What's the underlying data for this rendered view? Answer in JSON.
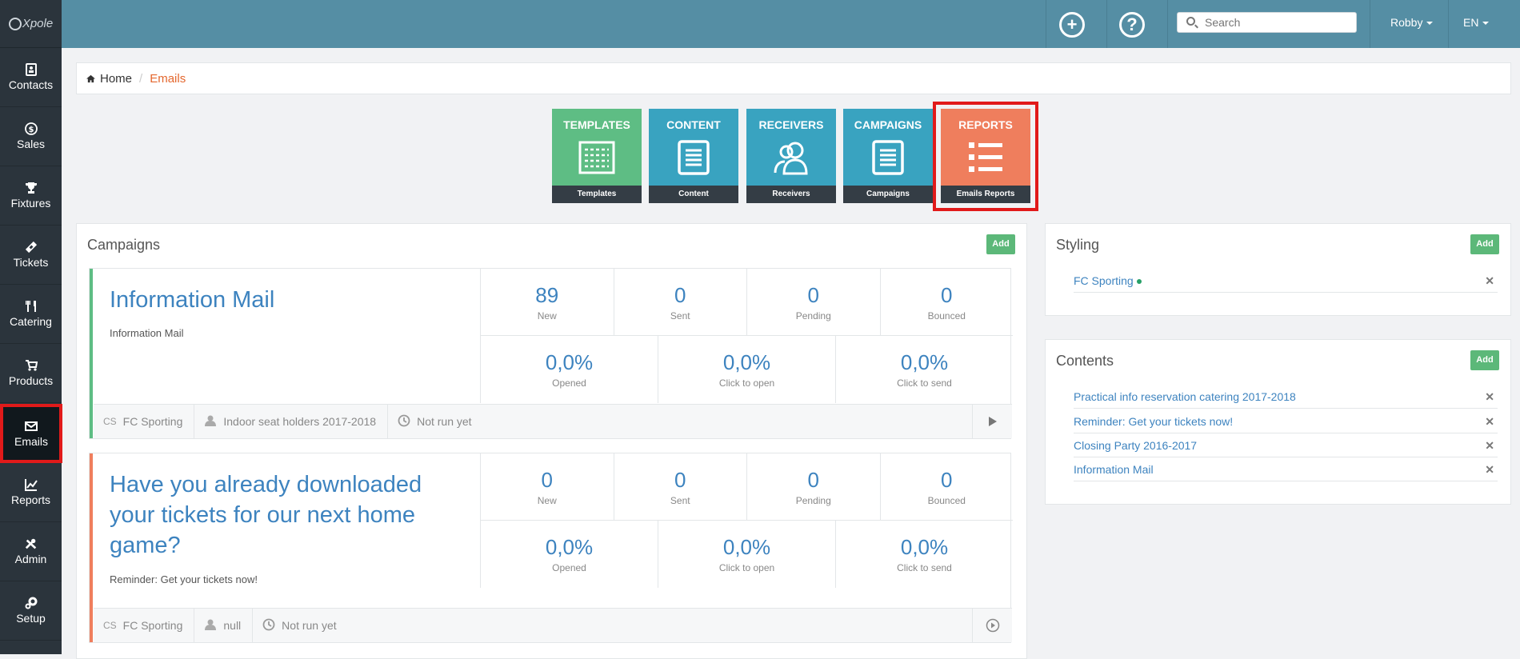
{
  "logo": "Xpole",
  "sidebar": {
    "items": [
      {
        "label": "Contacts",
        "icon": "contacts-icon"
      },
      {
        "label": "Sales",
        "icon": "dollar-icon"
      },
      {
        "label": "Fixtures",
        "icon": "trophy-icon"
      },
      {
        "label": "Tickets",
        "icon": "ticket-icon"
      },
      {
        "label": "Catering",
        "icon": "cutlery-icon"
      },
      {
        "label": "Products",
        "icon": "cart-icon"
      },
      {
        "label": "Emails",
        "icon": "envelope-icon"
      },
      {
        "label": "Reports",
        "icon": "line-chart-icon"
      },
      {
        "label": "Admin",
        "icon": "tools-icon"
      },
      {
        "label": "Setup",
        "icon": "cogs-icon"
      }
    ]
  },
  "topbar": {
    "search_placeholder": "Search",
    "user": "Robby",
    "lang": "EN"
  },
  "breadcrumb": {
    "home": "Home",
    "sep": "/",
    "current": "Emails"
  },
  "tiles": [
    {
      "title": "TEMPLATES",
      "footer": "Templates",
      "color": "#5ebd84"
    },
    {
      "title": "CONTENT",
      "footer": "Content",
      "color": "#39a3c0"
    },
    {
      "title": "RECEIVERS",
      "footer": "Receivers",
      "color": "#39a3c0"
    },
    {
      "title": "CAMPAIGNS",
      "footer": "Campaigns",
      "color": "#39a3c0"
    },
    {
      "title": "REPORTS",
      "footer": "Emails Reports",
      "color": "#ef7e5d"
    }
  ],
  "campaigns_panel": {
    "title": "Campaigns",
    "add": "Add"
  },
  "campaigns": [
    {
      "title": "Information Mail",
      "subtitle": "Information Mail",
      "accent": "#5ebd84",
      "stats_top": [
        {
          "v": "89",
          "l": "New"
        },
        {
          "v": "0",
          "l": "Sent"
        },
        {
          "v": "0",
          "l": "Pending"
        },
        {
          "v": "0",
          "l": "Bounced"
        }
      ],
      "stats_bottom": [
        {
          "v": "0,0%",
          "l": "Opened"
        },
        {
          "v": "0,0%",
          "l": "Click to open"
        },
        {
          "v": "0,0%",
          "l": "Click to send"
        }
      ],
      "footer": {
        "style": "FC Sporting",
        "receivers": "Indoor seat holders 2017-2018",
        "status": "Not run yet"
      }
    },
    {
      "title": "Have you already downloaded your tickets for our next home game?",
      "subtitle": "Reminder: Get your tickets now!",
      "accent": "#ef7e5d",
      "stats_top": [
        {
          "v": "0",
          "l": "New"
        },
        {
          "v": "0",
          "l": "Sent"
        },
        {
          "v": "0",
          "l": "Pending"
        },
        {
          "v": "0",
          "l": "Bounced"
        }
      ],
      "stats_bottom": [
        {
          "v": "0,0%",
          "l": "Opened"
        },
        {
          "v": "0,0%",
          "l": "Click to open"
        },
        {
          "v": "0,0%",
          "l": "Click to send"
        }
      ],
      "footer": {
        "style": "FC Sporting",
        "receivers": "null",
        "status": "Not run yet"
      }
    }
  ],
  "styling": {
    "title": "Styling",
    "add": "Add",
    "items": [
      "FC Sporting"
    ]
  },
  "contents": {
    "title": "Contents",
    "add": "Add",
    "items": [
      "Practical info reservation catering 2017-2018",
      "Reminder: Get your tickets now!",
      "Closing Party 2016-2017",
      "Information Mail"
    ]
  }
}
